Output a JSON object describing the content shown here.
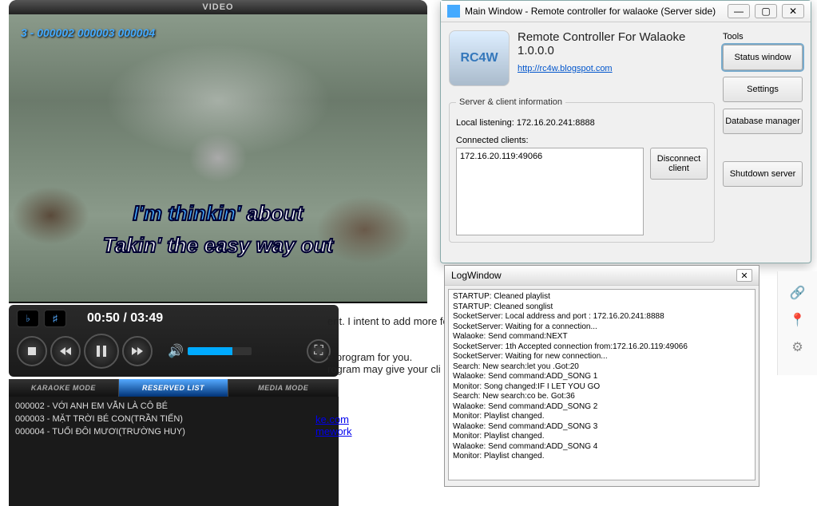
{
  "video": {
    "title": "VIDEO",
    "queue_overlay": "3 - 000002 000003 000004",
    "karaoke_done_1": "I'm thinkin'",
    "karaoke_rest_1": " about",
    "karaoke_line_2": "Takin' the easy way out",
    "time_current": "00:50",
    "time_total": "03:49"
  },
  "tabs": {
    "karaoke": "KARAOKE MODE",
    "reserved": "RESERVED LIST",
    "media": "MEDIA MODE"
  },
  "reserved": [
    "000002 - VỚI ANH EM VẪN LÀ CÔ BÉ",
    "000003 - MẶT TRỜI BÉ CON(TRẦN TIẾN)",
    "000004 - TUỔI ĐÔI MƯƠI(TRƯỜNG HUY)"
  ],
  "bg": {
    "line1": "ent. I intent to add more fe",
    "line2": "e program for you.",
    "line3": "rogram may give your cli",
    "link1": "ke.com",
    "link2": "mework"
  },
  "mainwin": {
    "title": "Main Window - Remote controller for walaoke (Server side)",
    "app_title": "Remote Controller For Walaoke 1.0.0.0",
    "app_logo": "RC4W",
    "app_link": "http://rc4w.blogspot.com",
    "group_label": "Server & client information",
    "local_listen": "Local listening: 172.16.20.241:8888",
    "cc_label": "Connected clients:",
    "clients": [
      "172.16.20.119:49066"
    ],
    "disconnect": "Disconnect client",
    "tools_label": "Tools",
    "btn_status": "Status window",
    "btn_settings": "Settings",
    "btn_db": "Database manager",
    "btn_shutdown": "Shutdown server"
  },
  "log": {
    "title": "LogWindow",
    "lines": "STARTUP: Cleaned playlist\nSTARTUP: Cleaned songlist\nSocketServer: Local address and port : 172.16.20.241:8888\nSocketServer: Waiting for a connection...\nWalaoke: Send command:NEXT\nSocketServer: 1th Accepted connection from:172.16.20.119:49066\nSocketServer: Waiting for new connection...\nSearch: New search:let you .Got:20\nWalaoke: Send command:ADD_SONG 1\nMonitor: Song changed:IF I LET YOU GO\nSearch: New search:co be. Got:36\nWalaoke: Send command:ADD_SONG 2\nMonitor: Playlist changed.\nWalaoke: Send command:ADD_SONG 3\nMonitor: Playlist changed.\nWalaoke: Send command:ADD_SONG 4\nMonitor: Playlist changed."
  }
}
